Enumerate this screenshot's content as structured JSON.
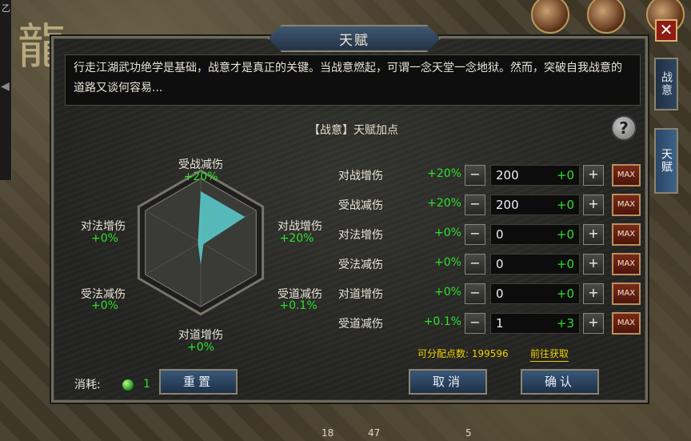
{
  "window": {
    "title": "天赋",
    "close_glyph": "✕"
  },
  "side_tabs": [
    {
      "label": "战意",
      "active": false
    },
    {
      "label": "天赋",
      "active": true
    }
  ],
  "description": "行走江湖武功绝学是基础，战意才是真正的关键。当战意燃起，可谓一念天堂一念地狱。然而，突破自我战意的道路又谈何容易...",
  "subtitle": "【战意】天赋加点",
  "help_glyph": "?",
  "chart_data": {
    "type": "radar",
    "axes": [
      {
        "name": "受战减伤",
        "value": "+20%",
        "level": 0.8
      },
      {
        "name": "对战增伤",
        "value": "+20%",
        "level": 0.8
      },
      {
        "name": "受道减伤",
        "value": "+0.1%",
        "level": 0
      },
      {
        "name": "对道增伤",
        "value": "+0%",
        "level": 0
      },
      {
        "name": "受法减伤",
        "value": "+0%",
        "level": 0
      },
      {
        "name": "对法增伤",
        "value": "+0%",
        "level": 0
      }
    ],
    "fill_color": "#5ac8c8"
  },
  "stats": [
    {
      "label": "对战增伤",
      "percent": "+20%",
      "points": "200",
      "added": "+0"
    },
    {
      "label": "受战减伤",
      "percent": "+20%",
      "points": "200",
      "added": "+0"
    },
    {
      "label": "对法增伤",
      "percent": "+0%",
      "points": "0",
      "added": "+0"
    },
    {
      "label": "受法减伤",
      "percent": "+0%",
      "points": "0",
      "added": "+0"
    },
    {
      "label": "对道增伤",
      "percent": "+0%",
      "points": "0",
      "added": "+0"
    },
    {
      "label": "受道减伤",
      "percent": "+0.1%",
      "points": "1",
      "added": "+3"
    }
  ],
  "controls": {
    "minus": "−",
    "plus": "+",
    "max": "MAX"
  },
  "available_points": "可分配点数: 199596",
  "get_link": "前往获取",
  "consume": {
    "label": "消耗:",
    "count": "1"
  },
  "buttons": {
    "reset": "重置",
    "cancel": "取消",
    "confirm": "确认"
  },
  "hud_numbers": [
    "18",
    "47",
    "5"
  ],
  "side_text": "乙"
}
